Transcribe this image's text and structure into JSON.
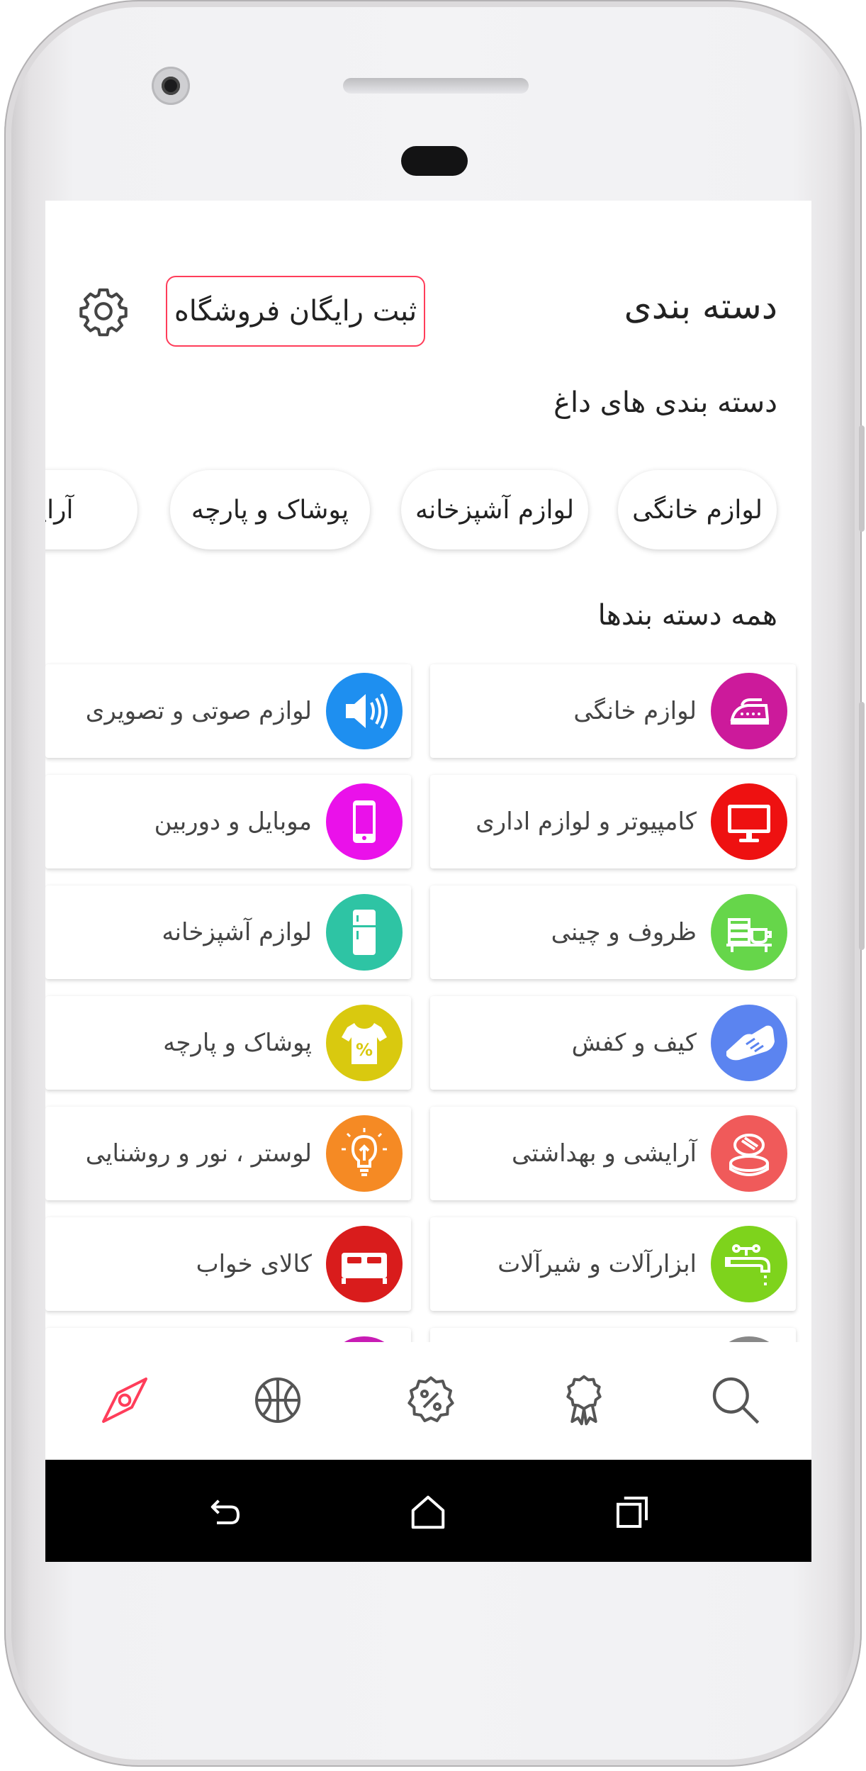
{
  "header": {
    "title": "دسته بندی",
    "register_button": "ثبت رایگان فروشگاه"
  },
  "hot_categories": {
    "title": "دسته بندی های داغ",
    "chips": [
      "لوازم خانگی",
      "لوازم آشپزخانه",
      "پوشاک و پارچه",
      "آرایشی"
    ]
  },
  "all_categories": {
    "title": "همه دسته بندها",
    "items": [
      {
        "label": "لوازم خانگی",
        "icon": "iron-icon",
        "color": "#cc1a9b"
      },
      {
        "label": "لوازم صوتی و تصویری",
        "icon": "speaker-icon",
        "color": "#1e8ff0"
      },
      {
        "label": "کامپیوتر و لوازم اداری",
        "icon": "monitor-icon",
        "color": "#ee1111"
      },
      {
        "label": "موبایل و دوربین",
        "icon": "mobile-icon",
        "color": "#ea11ea"
      },
      {
        "label": "ظروف و چینی",
        "icon": "dishes-icon",
        "color": "#66d64a"
      },
      {
        "label": "لوازم آشپزخانه",
        "icon": "fridge-icon",
        "color": "#2ec4a4"
      },
      {
        "label": "کیف و کفش",
        "icon": "shoe-icon",
        "color": "#5b84f0"
      },
      {
        "label": "پوشاک و پارچه",
        "icon": "tshirt-icon",
        "color": "#d9c90f"
      },
      {
        "label": "آرایشی و بهداشتی",
        "icon": "compact-icon",
        "color": "#f05a5a"
      },
      {
        "label": "لوستر ، نور و روشنایی",
        "icon": "bulb-icon",
        "color": "#f58a24"
      },
      {
        "label": "ابزارآلات و شیرآلات",
        "icon": "faucet-icon",
        "color": "#7ed31c"
      },
      {
        "label": "کالای خواب",
        "icon": "bed-icon",
        "color": "#d91c1c"
      }
    ]
  },
  "tabbar": {
    "active_color": "#ff3d5a",
    "items": [
      "compass-icon",
      "ball-icon",
      "discount-icon",
      "award-icon",
      "search-icon"
    ]
  },
  "system_nav": [
    "back-icon",
    "home-icon",
    "recents-icon"
  ]
}
